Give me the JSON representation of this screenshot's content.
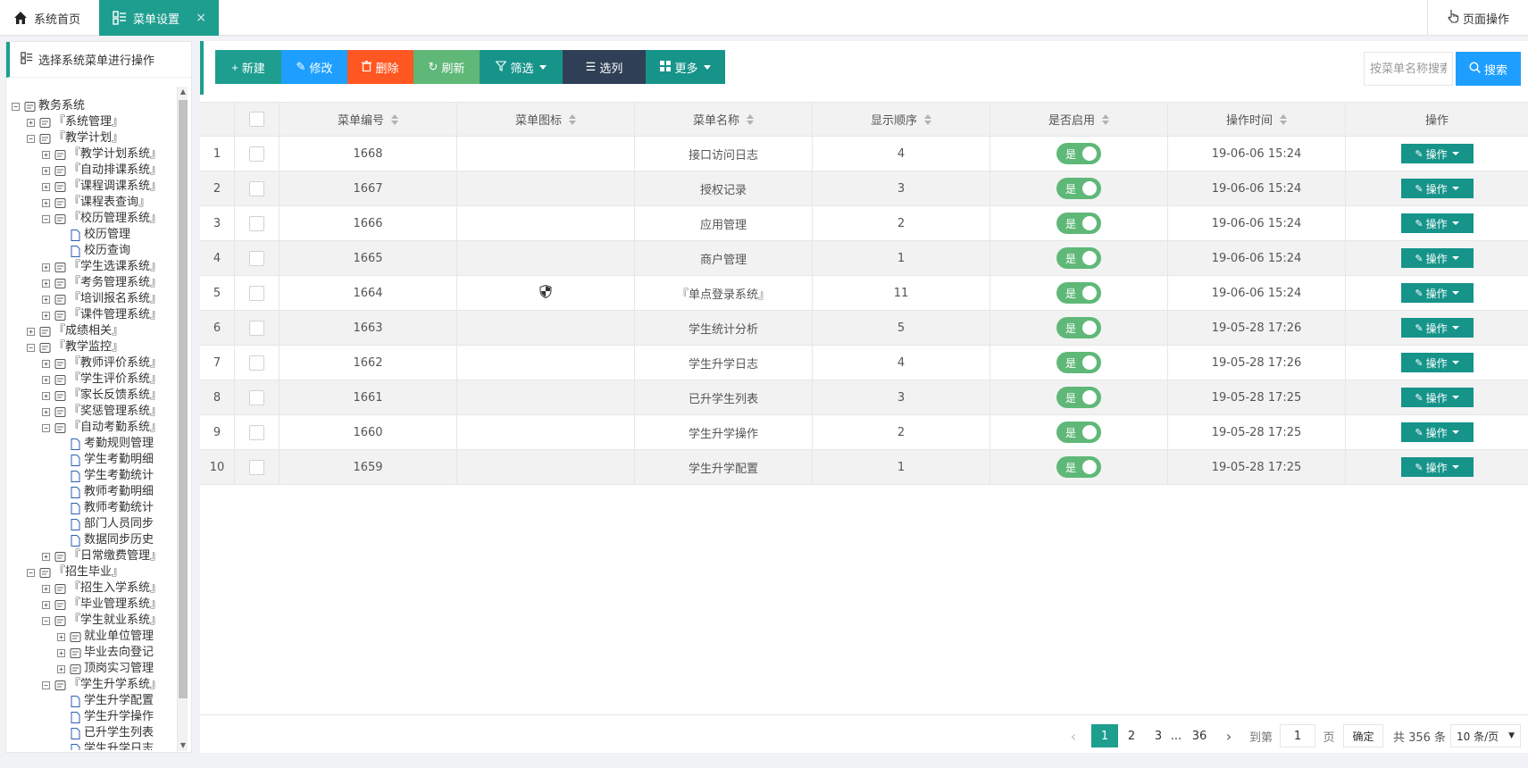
{
  "tabs": {
    "home": "系统首页",
    "active": "菜单设置",
    "close": "×",
    "page_ops": "页面操作"
  },
  "left_panel": {
    "title": "选择系统菜单进行操作"
  },
  "tree": [
    {
      "level": 0,
      "toggle": "−",
      "icon": "globe-icon",
      "label": "教务系统"
    },
    {
      "level": 1,
      "toggle": "+",
      "icon": "gear-icon",
      "label": "『系统管理』"
    },
    {
      "level": 1,
      "toggle": "−",
      "icon": "document-icon",
      "label": "『教学计划』"
    },
    {
      "level": 2,
      "toggle": "+",
      "icon": "calendar-icon",
      "label": "『教学计划系统』"
    },
    {
      "level": 2,
      "toggle": "+",
      "icon": "monitor-icon",
      "label": "『自动排课系统』"
    },
    {
      "level": 2,
      "toggle": "+",
      "icon": "calendar-icon",
      "label": "『课程调课系统』"
    },
    {
      "level": 2,
      "toggle": "+",
      "icon": "table-icon",
      "label": "『课程表查询』"
    },
    {
      "level": 2,
      "toggle": "−",
      "icon": "card-icon",
      "label": "『校历管理系统』"
    },
    {
      "level": 3,
      "toggle": "",
      "icon": "file-icon",
      "label": "校历管理"
    },
    {
      "level": 3,
      "toggle": "",
      "icon": "file-icon",
      "label": "校历查询"
    },
    {
      "level": 2,
      "toggle": "+",
      "icon": "clipboard-icon",
      "label": "『学生选课系统』"
    },
    {
      "level": 2,
      "toggle": "+",
      "icon": "chart-icon",
      "label": "『考务管理系统』"
    },
    {
      "level": 2,
      "toggle": "+",
      "icon": "person-card-icon",
      "label": "『培训报名系统』"
    },
    {
      "level": 2,
      "toggle": "+",
      "icon": "slides-icon",
      "label": "『课件管理系统』"
    },
    {
      "level": 1,
      "toggle": "+",
      "icon": "calculator-icon",
      "label": "『成绩相关』"
    },
    {
      "level": 1,
      "toggle": "−",
      "icon": "pulse-icon",
      "label": "『教学监控』"
    },
    {
      "level": 2,
      "toggle": "+",
      "icon": "teacher-icon",
      "label": "『教师评价系统』"
    },
    {
      "level": 2,
      "toggle": "+",
      "icon": "list-icon",
      "label": "『学生评价系统』"
    },
    {
      "level": 2,
      "toggle": "+",
      "icon": "user-icon",
      "label": "『家长反馈系统』"
    },
    {
      "level": 2,
      "toggle": "+",
      "icon": "gift-icon",
      "label": "『奖惩管理系统』"
    },
    {
      "level": 2,
      "toggle": "−",
      "icon": "users-icon",
      "label": "『自动考勤系统』"
    },
    {
      "level": 3,
      "toggle": "",
      "icon": "file-icon",
      "label": "考勤规则管理"
    },
    {
      "level": 3,
      "toggle": "",
      "icon": "file-icon",
      "label": "学生考勤明细"
    },
    {
      "level": 3,
      "toggle": "",
      "icon": "file-icon",
      "label": "学生考勤统计"
    },
    {
      "level": 3,
      "toggle": "",
      "icon": "file-icon",
      "label": "教师考勤明细"
    },
    {
      "level": 3,
      "toggle": "",
      "icon": "file-icon",
      "label": "教师考勤统计"
    },
    {
      "level": 3,
      "toggle": "",
      "icon": "file-icon",
      "label": "部门人员同步"
    },
    {
      "level": 3,
      "toggle": "",
      "icon": "file-icon",
      "label": "数据同步历史"
    },
    {
      "level": 2,
      "toggle": "+",
      "icon": "money-icon",
      "label": "『日常缴费管理』"
    },
    {
      "level": 1,
      "toggle": "−",
      "icon": "graduate-icon",
      "label": "『招生毕业』"
    },
    {
      "level": 2,
      "toggle": "+",
      "icon": "user-add-icon",
      "label": "『招生入学系统』"
    },
    {
      "level": 2,
      "toggle": "+",
      "icon": "cap-icon",
      "label": "『毕业管理系统』"
    },
    {
      "level": 2,
      "toggle": "−",
      "icon": "building-icon",
      "label": "『学生就业系统』"
    },
    {
      "level": 3,
      "toggle": "+",
      "icon": "worker-icon",
      "label": "就业单位管理"
    },
    {
      "level": 3,
      "toggle": "+",
      "icon": "id-card-icon",
      "label": "毕业去向登记"
    },
    {
      "level": 3,
      "toggle": "+",
      "icon": "network-icon",
      "label": "顶岗实习管理"
    },
    {
      "level": 2,
      "toggle": "−",
      "icon": "users-icon",
      "label": "『学生升学系统』"
    },
    {
      "level": 3,
      "toggle": "",
      "icon": "file-icon",
      "label": "学生升学配置"
    },
    {
      "level": 3,
      "toggle": "",
      "icon": "file-icon",
      "label": "学生升学操作"
    },
    {
      "level": 3,
      "toggle": "",
      "icon": "file-icon",
      "label": "已升学生列表"
    },
    {
      "level": 3,
      "toggle": "",
      "icon": "file-icon",
      "label": "学生升学日志"
    }
  ],
  "toolbar": {
    "new": "新建",
    "edit": "修改",
    "delete": "删除",
    "refresh": "刷新",
    "filter": "筛选",
    "columns": "选列",
    "more": "更多",
    "search_placeholder": "按菜单名称搜索",
    "search": "搜索"
  },
  "table": {
    "headers": {
      "menu_id": "菜单编号",
      "menu_icon": "菜单图标",
      "menu_name": "菜单名称",
      "order": "显示顺序",
      "enabled": "是否启用",
      "time": "操作时间",
      "action": "操作"
    },
    "rows": [
      {
        "no": "1",
        "id": "1668",
        "icon": "",
        "name": "接口访问日志",
        "order": "4",
        "enabled": "是",
        "time": "19-06-06 15:24"
      },
      {
        "no": "2",
        "id": "1667",
        "icon": "",
        "name": "授权记录",
        "order": "3",
        "enabled": "是",
        "time": "19-06-06 15:24"
      },
      {
        "no": "3",
        "id": "1666",
        "icon": "",
        "name": "应用管理",
        "order": "2",
        "enabled": "是",
        "time": "19-06-06 15:24"
      },
      {
        "no": "4",
        "id": "1665",
        "icon": "",
        "name": "商户管理",
        "order": "1",
        "enabled": "是",
        "time": "19-06-06 15:24"
      },
      {
        "no": "5",
        "id": "1664",
        "icon": "shield-icon",
        "name": "『单点登录系统』",
        "order": "11",
        "enabled": "是",
        "time": "19-06-06 15:24"
      },
      {
        "no": "6",
        "id": "1663",
        "icon": "",
        "name": "学生统计分析",
        "order": "5",
        "enabled": "是",
        "time": "19-05-28 17:26"
      },
      {
        "no": "7",
        "id": "1662",
        "icon": "",
        "name": "学生升学日志",
        "order": "4",
        "enabled": "是",
        "time": "19-05-28 17:26"
      },
      {
        "no": "8",
        "id": "1661",
        "icon": "",
        "name": "已升学生列表",
        "order": "3",
        "enabled": "是",
        "time": "19-05-28 17:25"
      },
      {
        "no": "9",
        "id": "1660",
        "icon": "",
        "name": "学生升学操作",
        "order": "2",
        "enabled": "是",
        "time": "19-05-28 17:25"
      },
      {
        "no": "10",
        "id": "1659",
        "icon": "",
        "name": "学生升学配置",
        "order": "1",
        "enabled": "是",
        "time": "19-05-28 17:25"
      }
    ],
    "action_label": "操作"
  },
  "pagination": {
    "prev": "‹",
    "pages": [
      "1",
      "2",
      "3"
    ],
    "dots": "...",
    "last": "36",
    "next": "›",
    "goto": "到第",
    "current": "1",
    "page_unit": "页",
    "confirm": "确定",
    "total": "共 356 条",
    "page_size": "10 条/页",
    "size_caret": "▼"
  },
  "colors": {
    "primary": "#1e9e8f",
    "blue": "#1e9fff",
    "red": "#ff5722",
    "green": "#5fb878",
    "dark": "#2f4056"
  }
}
